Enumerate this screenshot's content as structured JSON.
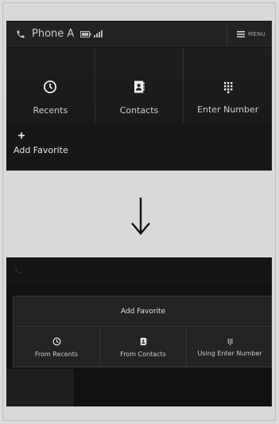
{
  "screen1": {
    "header": {
      "title": "Phone A",
      "menu_label": "MENU"
    },
    "tiles": [
      {
        "label": "Recents",
        "icon": "clock-icon"
      },
      {
        "label": "Contacts",
        "icon": "contacts-icon"
      },
      {
        "label": "Enter Number",
        "icon": "keypad-icon"
      }
    ],
    "add_favorite_label": "Add Favorite"
  },
  "screen2": {
    "dialog": {
      "title": "Add Favorite",
      "options": [
        {
          "label": "From Recents",
          "icon": "clock-icon"
        },
        {
          "label": "From Contacts",
          "icon": "contacts-icon"
        },
        {
          "label": "Using Enter Number",
          "icon": "keypad-icon"
        }
      ]
    }
  },
  "colors": {
    "screen_bg": "#1c1c1c",
    "text": "#d8d8d8",
    "page_bg": "#dcdcdc"
  }
}
